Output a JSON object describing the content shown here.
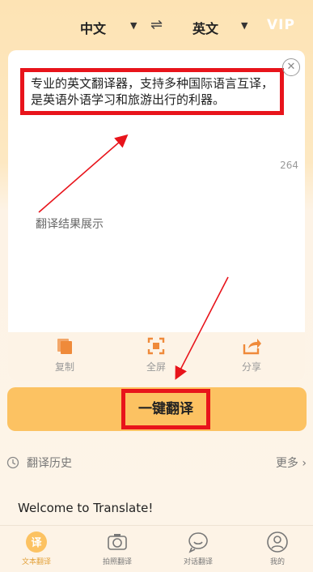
{
  "header": {
    "source_lang": "中文",
    "target_lang": "英文",
    "swap_icon": "⇌",
    "vip_label": "VIP"
  },
  "input": {
    "text": "专业的英文翻译器，支持多种国际语言互译，是英语外语学习和旅游出行的利器。",
    "char_count": "264",
    "clear_icon": "✕"
  },
  "result": {
    "placeholder": "翻译结果展示"
  },
  "toolbar": {
    "copy_label": "复制",
    "fullscreen_label": "全屏",
    "share_label": "分享"
  },
  "translate_button": {
    "label": "一键翻译"
  },
  "history": {
    "title": "翻译历史",
    "more_label": "更多 ›",
    "items": [
      "Welcome to Translate!"
    ]
  },
  "nav": {
    "items": [
      {
        "label": "文本翻译",
        "icon": "translate-icon",
        "active": true
      },
      {
        "label": "拍照翻译",
        "icon": "camera-icon",
        "active": false
      },
      {
        "label": "对话翻译",
        "icon": "chat-icon",
        "active": false
      },
      {
        "label": "我的",
        "icon": "profile-icon",
        "active": false
      }
    ]
  },
  "colors": {
    "accent": "#fcc262",
    "active_nav": "#e2a13a",
    "highlight_box": "#e8141b"
  }
}
